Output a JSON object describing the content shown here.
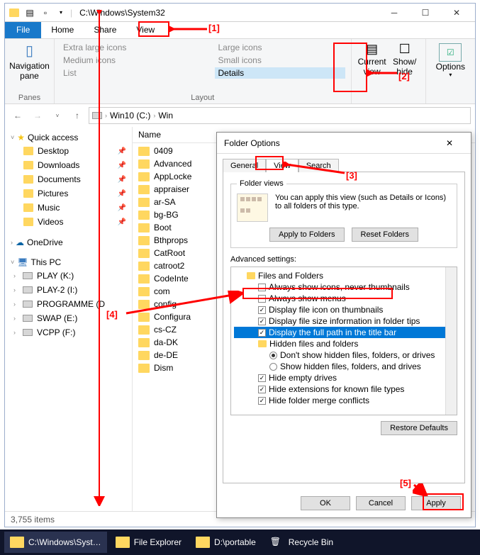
{
  "window": {
    "title": "C:\\Windows\\System32"
  },
  "ribbon_tabs": {
    "file": "File",
    "home": "Home",
    "share": "Share",
    "view": "View"
  },
  "ribbon": {
    "nav_pane": "Navigation\npane",
    "panes_label": "Panes",
    "layout": {
      "xl": "Extra large icons",
      "lg": "Large icons",
      "md": "Medium icons",
      "sm": "Small icons",
      "list": "List",
      "details": "Details"
    },
    "layout_label": "Layout",
    "current_view": "Current\nview",
    "show_hide": "Show/\nhide",
    "options": "Options"
  },
  "breadcrumbs": [
    "Win10 (C:)",
    "Win"
  ],
  "sidebar": {
    "quick_access": "Quick access",
    "qa_items": [
      "Desktop",
      "Downloads",
      "Documents",
      "Pictures",
      "Music",
      "Videos"
    ],
    "onedrive": "OneDrive",
    "this_pc": "This PC",
    "drives": [
      "PLAY (K:)",
      "PLAY-2 (I:)",
      "PROGRAMME (D",
      "SWAP (E:)",
      "VCPP (F:)"
    ]
  },
  "content": {
    "name_header": "Name",
    "folders": [
      "0409",
      "Advanced",
      "AppLocke",
      "appraiser",
      "ar-SA",
      "bg-BG",
      "Boot",
      "Bthprops",
      "CatRoot",
      "catroot2",
      "CodeInte",
      "com",
      "config",
      "Configura",
      "cs-CZ",
      "da-DK",
      "de-DE",
      "Dism"
    ]
  },
  "status": {
    "items": "3,755 items"
  },
  "dialog": {
    "title": "Folder Options",
    "tabs": {
      "general": "General",
      "view": "View",
      "search": "Search"
    },
    "folder_views_legend": "Folder views",
    "folder_views_text": "You can apply this view (such as Details or Icons) to all folders of this type.",
    "apply_to_folders": "Apply to Folders",
    "reset_folders": "Reset Folders",
    "advanced_label": "Advanced settings:",
    "tree": {
      "root": "Files and Folders",
      "i1": "Always show icons, never thumbnails",
      "i2": "Always show menus",
      "i3": "Display file icon on thumbnails",
      "i4": "Display file size information in folder tips",
      "i5": "Display the full path in the title bar",
      "hidden": "Hidden files and folders",
      "h1": "Don't show hidden files, folders, or drives",
      "h2": "Show hidden files, folders, and drives",
      "i6": "Hide empty drives",
      "i7": "Hide extensions for known file types",
      "i8": "Hide folder merge conflicts"
    },
    "restore_defaults": "Restore Defaults",
    "ok": "OK",
    "cancel": "Cancel",
    "apply": "Apply"
  },
  "annotations": {
    "a1": "[1]",
    "a2": "[2]",
    "a3": "[3]",
    "a4": "[4]",
    "a5": "[5]"
  },
  "taskbar": {
    "t1": "C:\\Windows\\Syst…",
    "t2": "File Explorer",
    "t3": "D:\\portable",
    "t4": "Recycle Bin"
  }
}
